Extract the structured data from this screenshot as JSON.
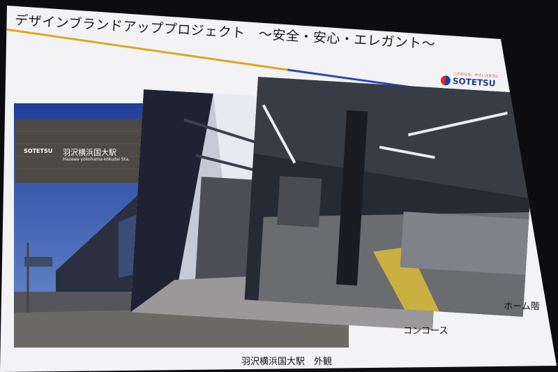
{
  "slide": {
    "title": "デザインブランドアッププロジェクト　～安全・安心・エレガント～",
    "accent_colors": {
      "gold": "#d9a820",
      "blue": "#2a49b8"
    }
  },
  "logo": {
    "tagline": "これからも、やさしさを力に",
    "name": "SOTETSU"
  },
  "photos": {
    "exterior": {
      "station_sign_name_jp": "羽沢横浜国大駅",
      "station_sign_name_en": "Hazawa yokohama-kokudai Sta.",
      "station_sign_brand": "SOTETSU"
    }
  },
  "captions": {
    "exterior": "羽沢横浜国大駅　外観",
    "concourse": "コンコース",
    "platform": "ホーム階"
  }
}
